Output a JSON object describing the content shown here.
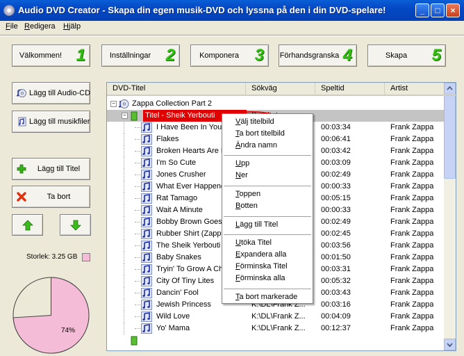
{
  "window": {
    "title": "Audio DVD Creator - Skapa din egen musik-DVD och lyssna på den i din DVD-spelare!"
  },
  "menubar": [
    "File",
    "Redigera",
    "Hjälp"
  ],
  "steps": [
    {
      "label": "Välkommen!",
      "num": "1"
    },
    {
      "label": "Inställningar",
      "num": "2"
    },
    {
      "label": "Komponera",
      "num": "3"
    },
    {
      "label": "Förhandsgranska",
      "num": "4"
    },
    {
      "label": "Skapa",
      "num": "5"
    }
  ],
  "side": {
    "add_cd": "Lägg till Audio-CD",
    "add_files": "Lägg till musikfiler",
    "add_title": "Lägg till Titel",
    "remove": "Ta bort"
  },
  "size": {
    "label": "Storlek: 3.25 GB",
    "percent_text": "74%",
    "used_fraction": 0.74
  },
  "columns": [
    "DVD-Titel",
    "Sökväg",
    "Speltid",
    "Artist"
  ],
  "tree": {
    "collection": "Zappa Collection Part 2",
    "title1_name": "Titel - Sheik Yerbouti",
    "title1_path": "Prioritet..."
  },
  "tracks": [
    {
      "name": "I Have Been In You",
      "path": "",
      "time": "00:03:34",
      "artist": "Frank Zappa"
    },
    {
      "name": "Flakes",
      "path": "",
      "time": "00:06:41",
      "artist": "Frank Zappa"
    },
    {
      "name": "Broken Hearts Are F",
      "path": "",
      "time": "00:03:42",
      "artist": "Frank Zappa"
    },
    {
      "name": "I'm So Cute",
      "path": "",
      "time": "00:03:09",
      "artist": "Frank Zappa"
    },
    {
      "name": "Jones Crusher",
      "path": "",
      "time": "00:02:49",
      "artist": "Frank Zappa"
    },
    {
      "name": "What Ever Happene",
      "path": "",
      "time": "00:00:33",
      "artist": "Frank Zappa"
    },
    {
      "name": "Rat Tamago",
      "path": "",
      "time": "00:05:15",
      "artist": "Frank Zappa"
    },
    {
      "name": "Wait A Minute",
      "path": "",
      "time": "00:00:33",
      "artist": "Frank Zappa"
    },
    {
      "name": "Bobby Brown Goes",
      "path": "",
      "time": "00:02:49",
      "artist": "Frank Zappa"
    },
    {
      "name": "Rubber Shirt (Zappa",
      "path": "",
      "time": "00:02:45",
      "artist": "Frank Zappa"
    },
    {
      "name": "The Sheik Yerbouti",
      "path": "",
      "time": "00:03:56",
      "artist": "Frank Zappa"
    },
    {
      "name": "Baby Snakes",
      "path": "",
      "time": "00:01:50",
      "artist": "Frank Zappa"
    },
    {
      "name": "Tryin' To Grow A Ch",
      "path": "",
      "time": "00:03:31",
      "artist": "Frank Zappa"
    },
    {
      "name": "City Of Tiny Lites",
      "path": "",
      "time": "00:05:32",
      "artist": "Frank Zappa"
    },
    {
      "name": "Dancin' Fool",
      "path": "",
      "time": "00:03:43",
      "artist": "Frank Zappa"
    },
    {
      "name": "Jewish Princess",
      "path": "K:\\DL\\Frank Z...",
      "time": "00:03:16",
      "artist": "Frank Zappa"
    },
    {
      "name": "Wild Love",
      "path": "K:\\DL\\Frank Z...",
      "time": "00:04:09",
      "artist": "Frank Zappa"
    },
    {
      "name": "Yo' Mama",
      "path": "K:\\DL\\Frank Z...",
      "time": "00:12:37",
      "artist": "Frank Zappa"
    }
  ],
  "context_menu": {
    "groups": [
      [
        "Välj titelbild",
        "Ta bort titelbild",
        "Ändra namn"
      ],
      [
        "Upp",
        "Ner"
      ],
      [
        "Toppen",
        "Botten"
      ],
      [
        "Lägg till Titel"
      ],
      [
        "Utöka Titel",
        "Expandera alla",
        "Förminska Titel",
        "Förminska alla"
      ],
      [
        "Ta bort markerade"
      ]
    ]
  },
  "colors": {
    "title_blue": "#0548c4",
    "step_green": "#36c014",
    "pie_used": "#f4bcd6",
    "pie_free": "#ece9d8",
    "highlight_red": "#e00000"
  }
}
